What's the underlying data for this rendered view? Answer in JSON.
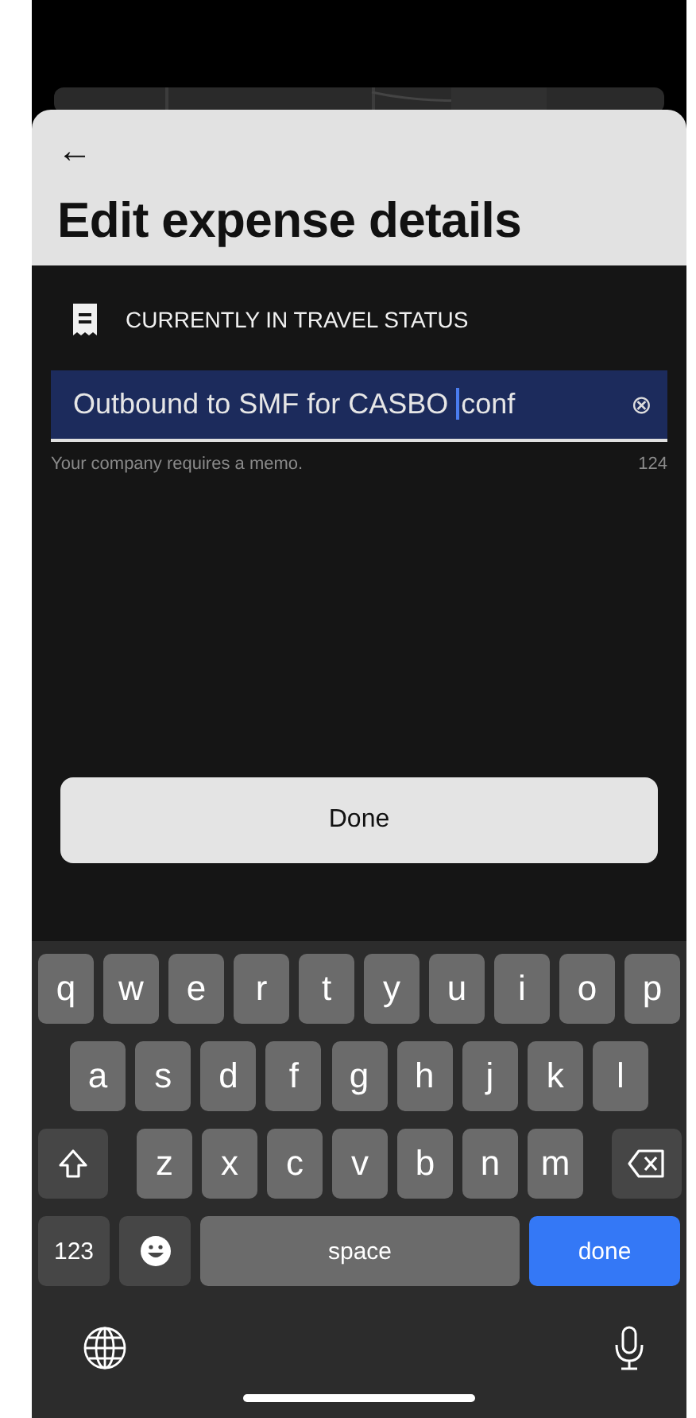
{
  "sheet": {
    "back_icon": "←",
    "title": "Edit expense details"
  },
  "status": {
    "label": "CURRENTLY IN TRAVEL STATUS"
  },
  "memo": {
    "value_before_caret": "Outbound to SMF for CASBO",
    "value_after_caret": "conf",
    "clear_icon": "⊗",
    "helper": "Your company requires a memo.",
    "count": "124"
  },
  "done_button": "Done",
  "keyboard": {
    "rows": [
      {
        "keys": [
          {
            "kind": "letter",
            "label": "q"
          },
          {
            "kind": "letter",
            "label": "w"
          },
          {
            "kind": "letter",
            "label": "e"
          },
          {
            "kind": "letter",
            "label": "r"
          },
          {
            "kind": "letter",
            "label": "t"
          },
          {
            "kind": "letter",
            "label": "y"
          },
          {
            "kind": "letter",
            "label": "u"
          },
          {
            "kind": "letter",
            "label": "i"
          },
          {
            "kind": "letter",
            "label": "o"
          },
          {
            "kind": "letter",
            "label": "p"
          }
        ]
      },
      {
        "keys": [
          {
            "kind": "letter",
            "label": "a"
          },
          {
            "kind": "letter",
            "label": "s"
          },
          {
            "kind": "letter",
            "label": "d"
          },
          {
            "kind": "letter",
            "label": "f"
          },
          {
            "kind": "letter",
            "label": "g"
          },
          {
            "kind": "letter",
            "label": "h"
          },
          {
            "kind": "letter",
            "label": "j"
          },
          {
            "kind": "letter",
            "label": "k"
          },
          {
            "kind": "letter",
            "label": "l"
          }
        ]
      },
      {
        "keys": [
          {
            "kind": "shift"
          },
          {
            "kind": "letter",
            "label": "z"
          },
          {
            "kind": "letter",
            "label": "x"
          },
          {
            "kind": "letter",
            "label": "c"
          },
          {
            "kind": "letter",
            "label": "v"
          },
          {
            "kind": "letter",
            "label": "b"
          },
          {
            "kind": "letter",
            "label": "n"
          },
          {
            "kind": "letter",
            "label": "m"
          },
          {
            "kind": "delete"
          }
        ]
      },
      {
        "keys": [
          {
            "kind": "mode",
            "label": "123"
          },
          {
            "kind": "emoji"
          },
          {
            "kind": "space",
            "label": "space"
          },
          {
            "kind": "return",
            "label": "done"
          }
        ]
      }
    ]
  }
}
